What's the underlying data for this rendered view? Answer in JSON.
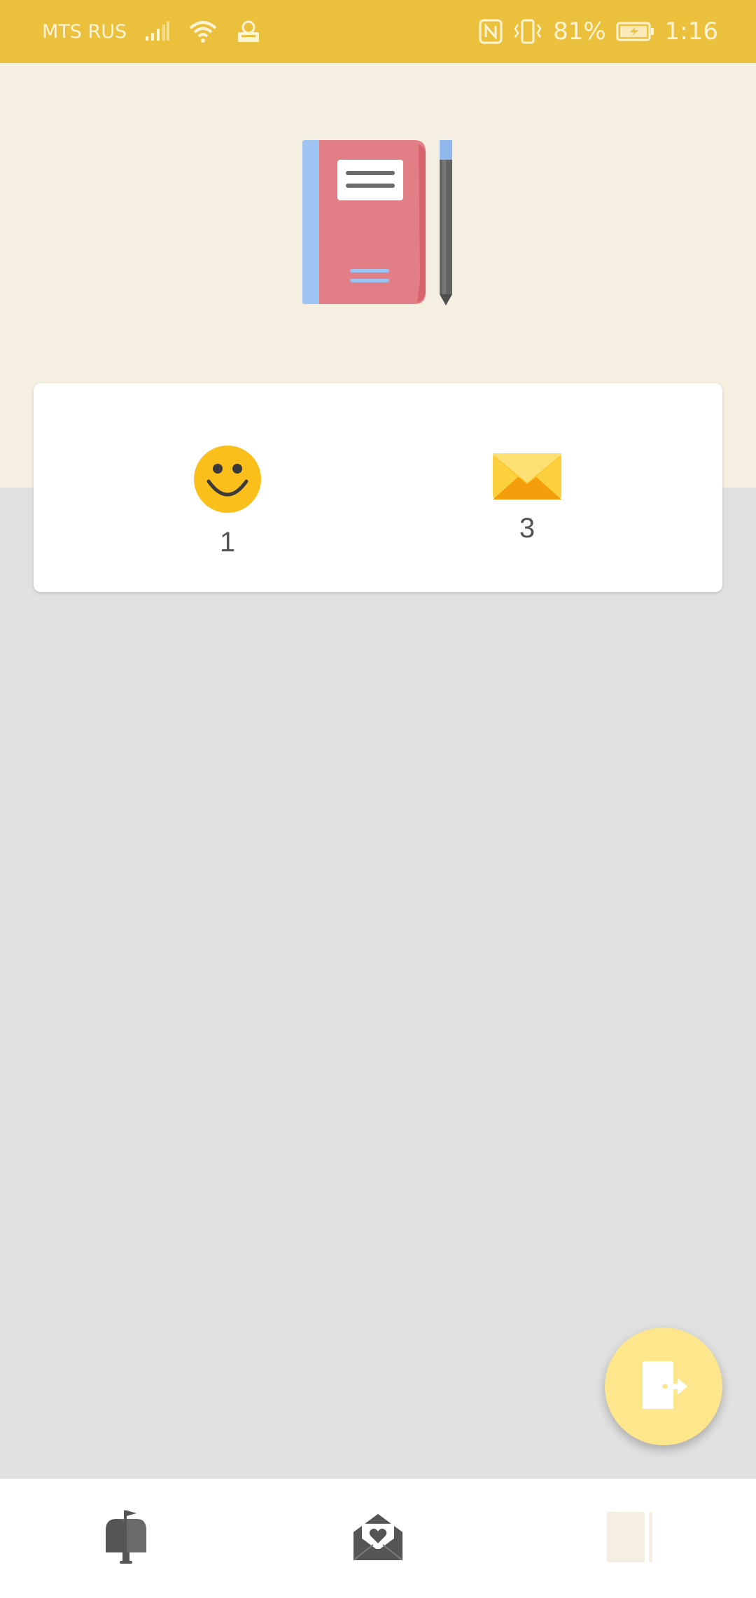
{
  "status_bar": {
    "carrier": "MTS RUS",
    "battery_percent": "81%",
    "time": "1:16",
    "icons": [
      "signal-icon",
      "wifi-icon",
      "vpn-icon",
      "nfc-icon",
      "vibrate-icon",
      "battery-charging-icon"
    ]
  },
  "header": {
    "illustration": "notebook-pen-icon"
  },
  "stats": {
    "smiles": {
      "icon": "smiley-icon",
      "value": "1"
    },
    "letters": {
      "icon": "envelope-icon",
      "value": "3"
    }
  },
  "fab": {
    "icon": "exit-door-icon",
    "color": "#fde68b"
  },
  "bottom_nav": {
    "items": [
      {
        "icon": "mailbox-icon",
        "active": false
      },
      {
        "icon": "love-letter-icon",
        "active": false
      },
      {
        "icon": "diary-icon",
        "active": true
      }
    ]
  },
  "colors": {
    "status_bar": "#ebc03c",
    "hero_background": "#f5efe1",
    "page_background": "#e1e1e1",
    "accent_yellow": "#fbbf24"
  }
}
